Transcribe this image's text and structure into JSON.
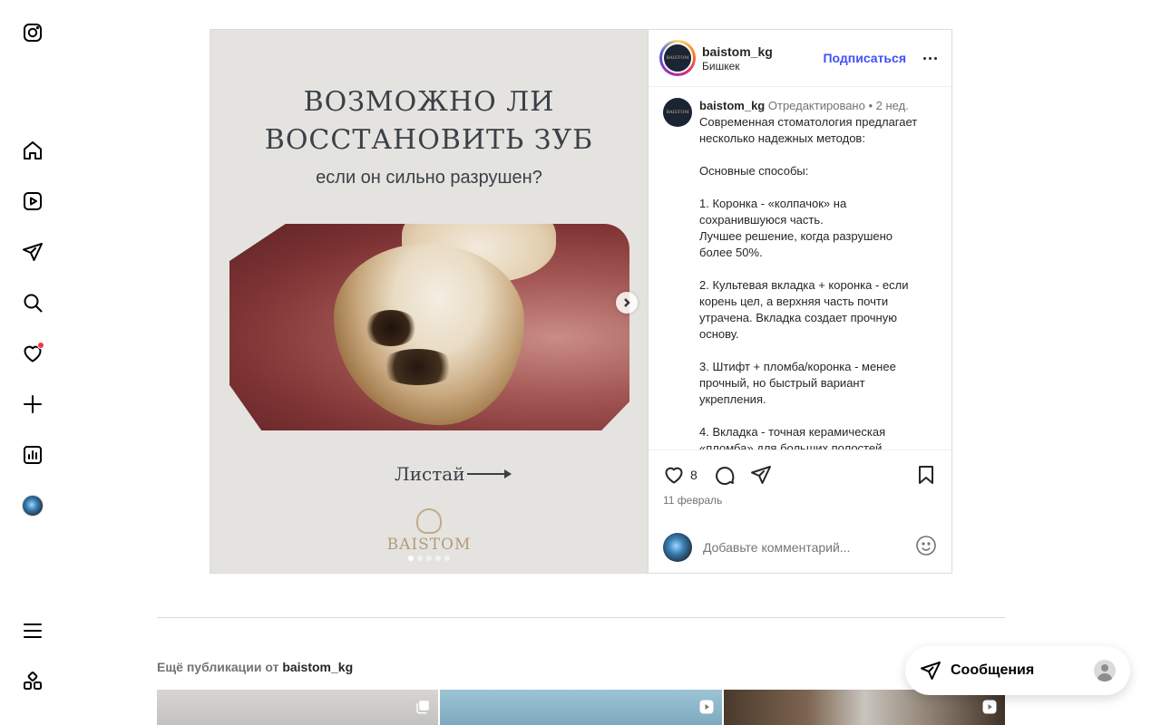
{
  "post": {
    "media": {
      "title_line1": "ВОЗМОЖНО ЛИ",
      "title_line2": "ВОССТАНОВИТЬ ЗУБ",
      "subtitle": "если он сильно разрушен?",
      "swipe_label": "Листай",
      "brand": "BAISTOM",
      "slide_count": 5,
      "current_slide": 1
    },
    "header": {
      "username": "baistom_kg",
      "location": "Бишкек",
      "follow_label": "Подписаться",
      "avatar_text": "BAISTOM"
    },
    "caption": {
      "username": "baistom_kg",
      "edited": "Отредактировано",
      "separator": "•",
      "time": "2 нед.",
      "lines": [
        "Современная стоматология предлагает",
        "несколько надежных методов:",
        "",
        "Основные способы:",
        "",
        "1. Коронка - «колпачок» на",
        "сохранившуюся часть.",
        "Лучшее решение, когда разрушено",
        "более 50%.",
        "",
        "2. Культевая вкладка + коронка - если",
        "корень цел, а верхняя часть почти",
        "утрачена. Вкладка создает прочную",
        "основу.",
        "",
        "3. Штифт + пломба/коронка - менее",
        "прочный, но быстрый вариант",
        "укрепления.",
        "",
        "4. Вкладка - точная керамическая",
        "«пломба» для больших полостей"
      ]
    },
    "likes": "8",
    "date": "11 февраль",
    "comment_placeholder": "Добавьте комментарий..."
  },
  "more_posts": {
    "prefix": "Ещё публикации от",
    "username": "baistom_kg"
  },
  "messages": {
    "label": "Сообщения"
  },
  "colors": {
    "accent": "#4150f7",
    "notification": "#ff3040"
  }
}
